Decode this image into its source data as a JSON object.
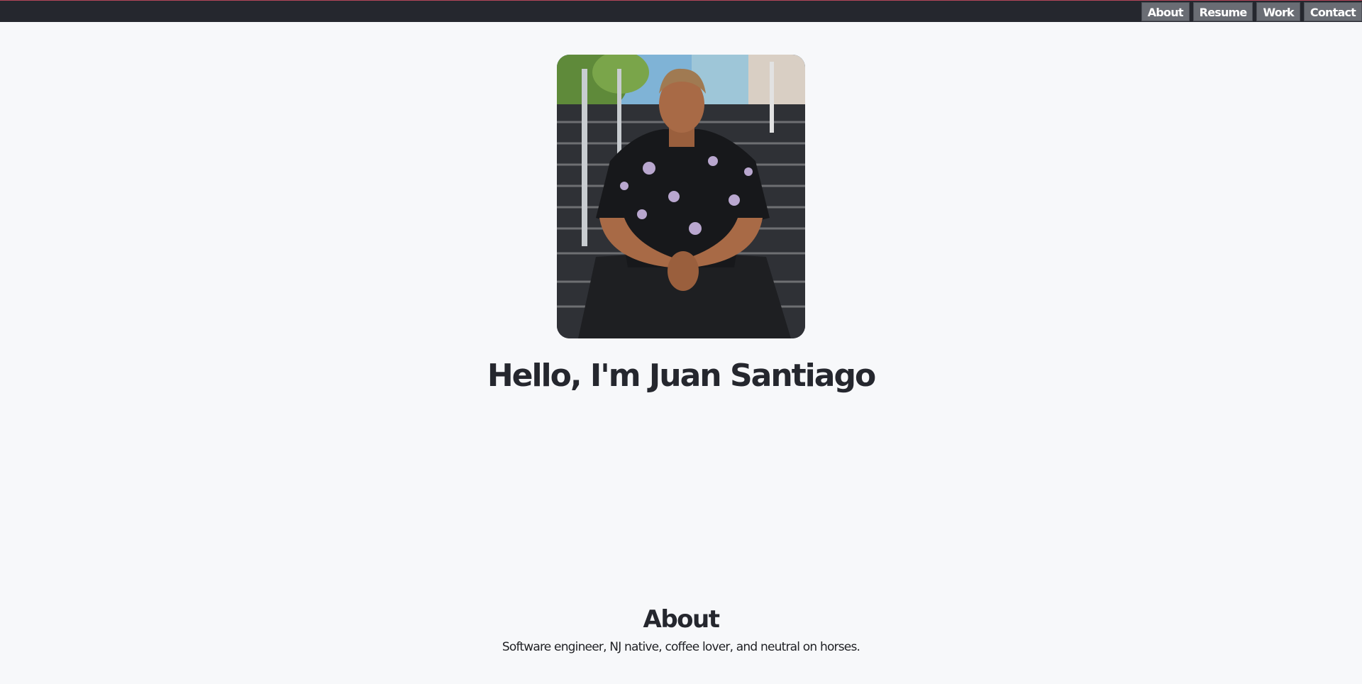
{
  "nav": {
    "items": [
      {
        "label": "About"
      },
      {
        "label": "Resume"
      },
      {
        "label": "Work"
      },
      {
        "label": "Contact"
      }
    ]
  },
  "hero": {
    "heading": "Hello, I'm Juan Santiago"
  },
  "about": {
    "title": "About",
    "text": "Software engineer, NJ native, coffee lover, and neutral on horses."
  },
  "colors": {
    "topbar": "#25272e",
    "topbar_accent": "#b4465a",
    "nav_button": "#6a6d74",
    "page_background": "#f7f8fa",
    "heading_text": "#25272e"
  }
}
